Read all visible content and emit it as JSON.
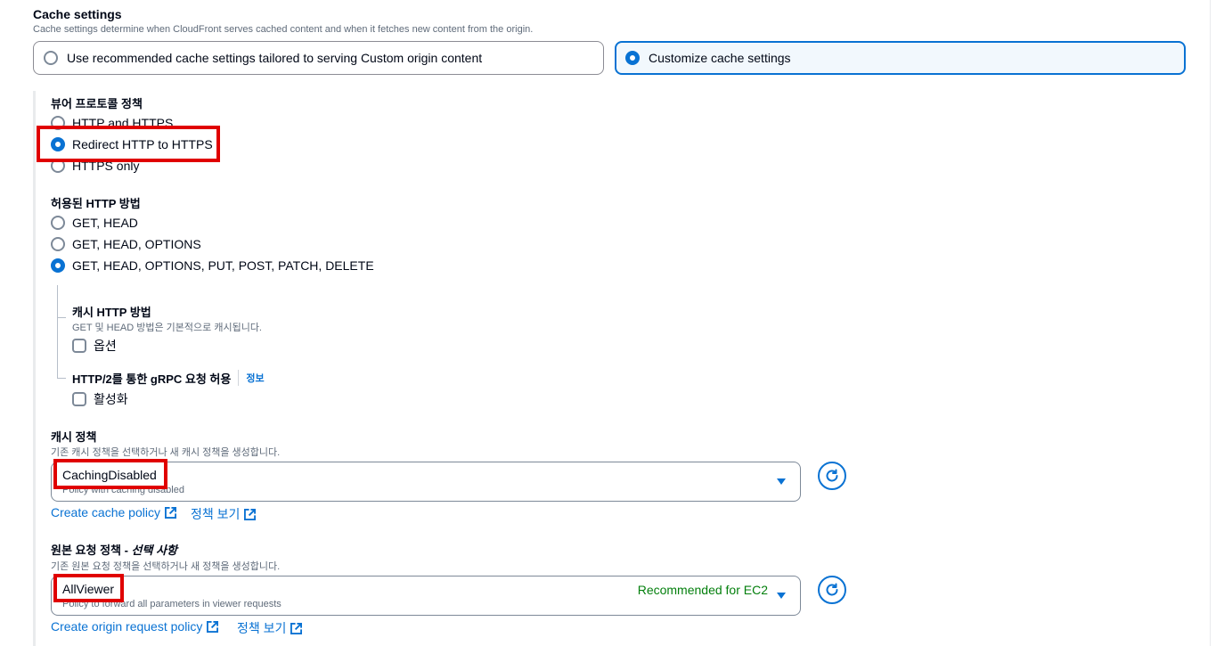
{
  "cache_settings": {
    "title": "Cache settings",
    "description": "Cache settings determine when CloudFront serves cached content and when it fetches new content from the origin.",
    "tiles": [
      {
        "label": "Use recommended cache settings tailored to serving Custom origin content",
        "selected": false
      },
      {
        "label": "Customize cache settings",
        "selected": true
      }
    ]
  },
  "viewer_protocol": {
    "title": "뷰어 프로토콜 정책",
    "options": [
      {
        "label": "HTTP and HTTPS",
        "selected": false
      },
      {
        "label": "Redirect HTTP to HTTPS",
        "selected": true
      },
      {
        "label": "HTTPS only",
        "selected": false
      }
    ]
  },
  "allowed_methods": {
    "title": "허용된 HTTP 방법",
    "options": [
      {
        "label": "GET, HEAD",
        "selected": false
      },
      {
        "label": "GET, HEAD, OPTIONS",
        "selected": false
      },
      {
        "label": "GET, HEAD, OPTIONS, PUT, POST, PATCH, DELETE",
        "selected": true
      }
    ]
  },
  "cached_methods": {
    "title": "캐시 HTTP 방법",
    "description": "GET 및 HEAD 방법은 기본적으로 캐시됩니다.",
    "checkbox_label": "옵션"
  },
  "grpc": {
    "title": "HTTP/2를 통한 gRPC 요청 허용",
    "info": "정보",
    "checkbox_label": "활성화"
  },
  "cache_policy": {
    "title": "캐시 정책",
    "description": "기존 캐시 정책을 선택하거나 새 캐시 정책을 생성합니다.",
    "selected": "CachingDisabled",
    "selected_sub": "Policy with caching disabled",
    "create_link": "Create cache policy",
    "view_link": "정책 보기"
  },
  "origin_request_policy": {
    "title": "원본 요청 정책 - ",
    "title_optional": "선택 사항",
    "description": "기존 원본 요청 정책을 선택하거나 새 정책을 생성합니다.",
    "selected": "AllViewer",
    "selected_sub": "Policy to forward all parameters in viewer requests",
    "badge": "Recommended for EC2",
    "create_link": "Create origin request policy",
    "view_link": "정책 보기"
  },
  "colors": {
    "accent": "#0972d3",
    "highlight": "#e00000",
    "recommended": "#037f0c"
  }
}
